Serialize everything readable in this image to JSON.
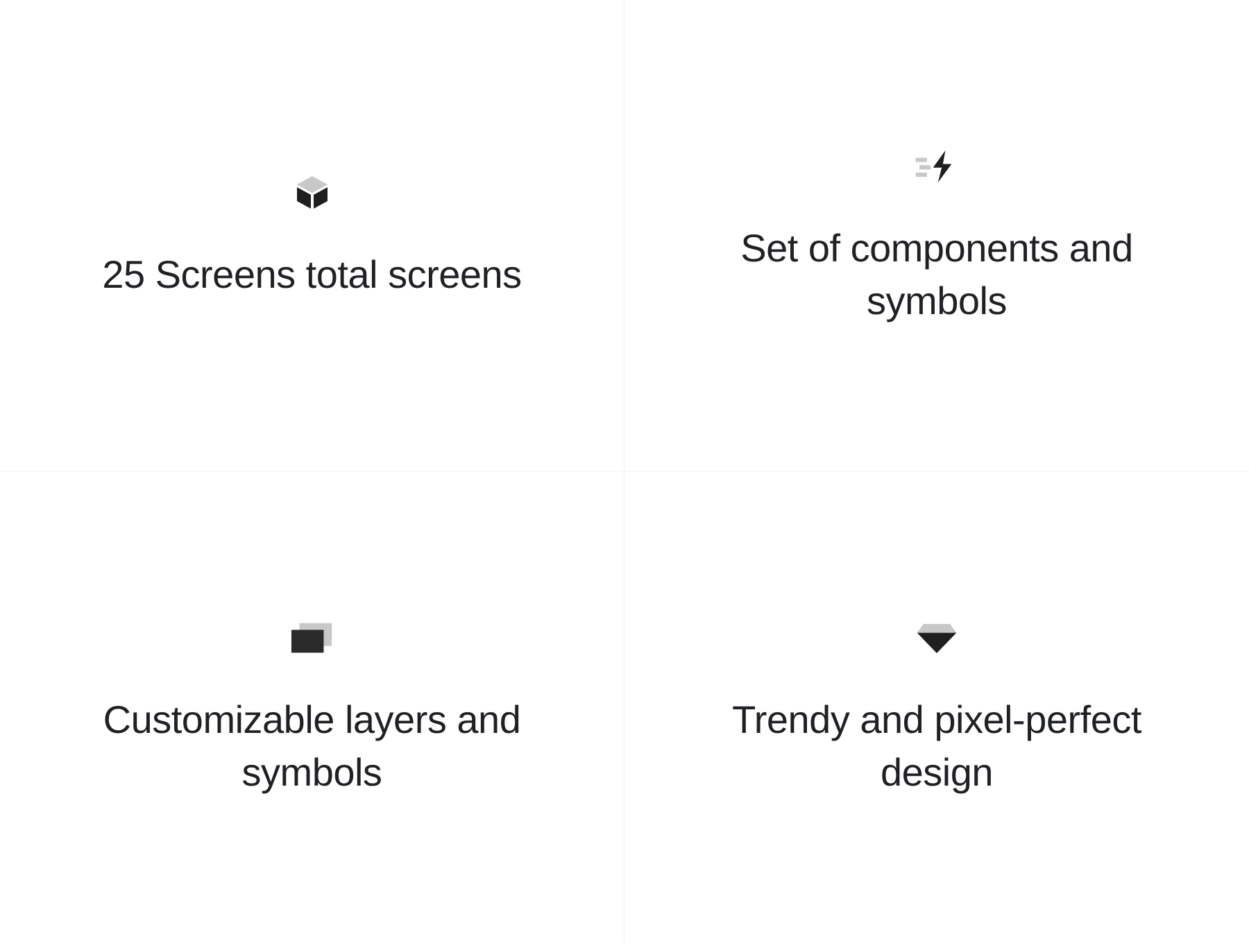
{
  "features": [
    {
      "title": "25 Screens total screens",
      "icon": "box-icon"
    },
    {
      "title": "Set of components and symbols",
      "icon": "bolt-lines-icon"
    },
    {
      "title": "Customizable layers and symbols",
      "icon": "layers-icon"
    },
    {
      "title": "Trendy and pixel-perfect design",
      "icon": "diamond-icon"
    }
  ]
}
